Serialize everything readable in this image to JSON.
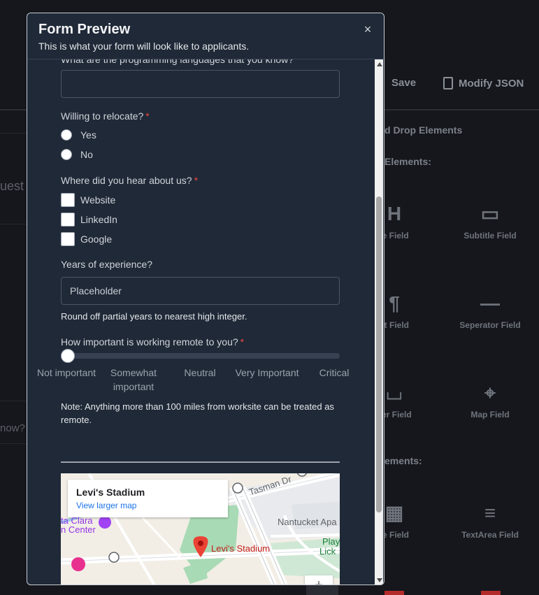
{
  "background": {
    "toolbar": {
      "save_label": "Save",
      "modify_json_label": "Modify JSON"
    },
    "panel_title": "d Drop Elements",
    "section1_title": "Elements:",
    "section2_title": "ements:",
    "left_text_1": "uest",
    "left_text_2": "now?",
    "tiles": [
      {
        "label": "le Field",
        "icon": "heading-icon"
      },
      {
        "label": "Subtitle Field",
        "icon": "subtitle-icon"
      },
      {
        "label": "xt Field",
        "icon": "paragraph-icon"
      },
      {
        "label": "Seperator Field",
        "icon": "separator-icon"
      },
      {
        "label": "cer Field",
        "icon": "spacer-icon"
      },
      {
        "label": "Map Field",
        "icon": "map-pin-icon"
      },
      {
        "label": "te Field",
        "icon": "calendar-icon"
      },
      {
        "label": "TextArea Field",
        "icon": "textarea-icon"
      }
    ]
  },
  "modal": {
    "title": "Form Preview",
    "subtitle": "This is what your form will look like to applicants.",
    "close_glyph": "×"
  },
  "form": {
    "q_languages": {
      "label": "What are the programming languages that you know?",
      "value": ""
    },
    "q_relocate": {
      "label": "Willing to relocate?",
      "required_mark": "*",
      "options": [
        "Yes",
        "No"
      ]
    },
    "q_hear": {
      "label": "Where did you hear about us?",
      "required_mark": "*",
      "options": [
        "Website",
        "LinkedIn",
        "Google"
      ]
    },
    "q_experience": {
      "label": "Years of experience?",
      "placeholder": "Placeholder",
      "helper": "Round off partial years to nearest high integer."
    },
    "q_remote": {
      "label": "How important is working remote to you?",
      "required_mark": "*",
      "slider_value": 0,
      "marks": [
        "Not important",
        "Somewhat important",
        "Neutral",
        "Very Important",
        "Critical"
      ],
      "note": "Note: Anything more than 100 miles from worksite can be treated as remote."
    },
    "map": {
      "place_title": "Levi's Stadium",
      "larger_map_link": "View larger map",
      "pin_label": "Levi's Stadium",
      "road_label": "Tasman Dr",
      "area_label_1": "Nantucket Apa",
      "area_label_2": "Play",
      "area_label_3": "Lick",
      "poi_label_1": "ta Clara",
      "poi_label_2": "n Center",
      "zoom_glyph": "+"
    }
  }
}
